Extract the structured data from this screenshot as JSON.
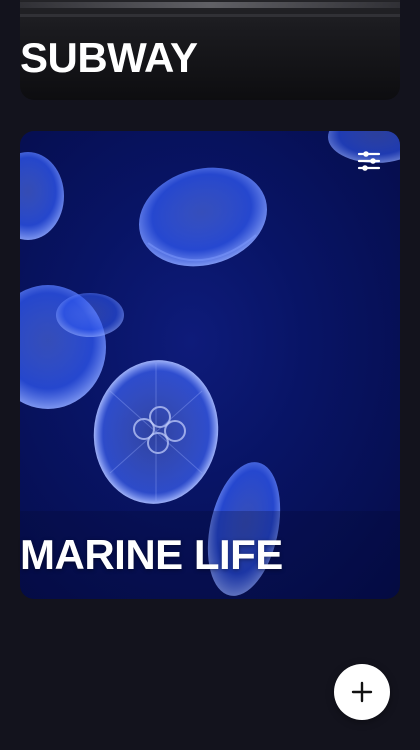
{
  "cards": [
    {
      "title": "SUBWAY"
    },
    {
      "title": "MARINE LIFE"
    }
  ],
  "icons": {
    "filter": "sliders-icon",
    "add": "plus-icon"
  },
  "colors": {
    "background": "#13131d",
    "marine_deep": "#050c48",
    "jellyfish": "#3a6bff",
    "fab": "#ffffff"
  }
}
